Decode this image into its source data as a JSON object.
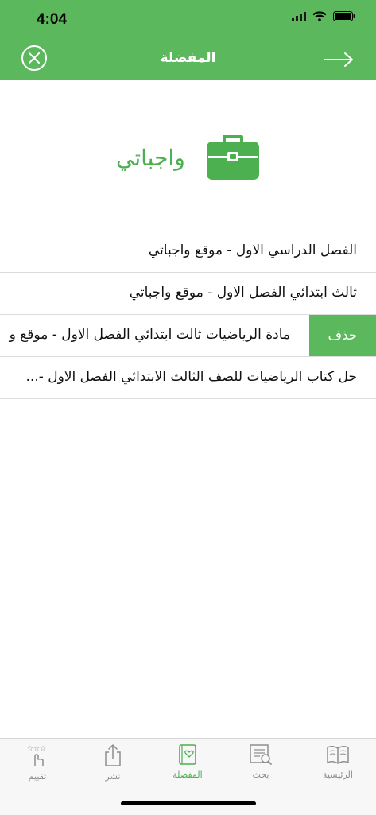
{
  "status_bar": {
    "time": "4:04"
  },
  "nav": {
    "title": "المفضلة"
  },
  "logo": {
    "text": "واجباتي"
  },
  "favorites": [
    {
      "title": "الفصل الدراسي الاول - موقع واجباتي"
    },
    {
      "title": "ثالث ابتدائي الفصل الاول - موقع واجباتي"
    },
    {
      "title": "مادة الرياضيات ثالث ابتدائي الفصل الاول - موقع و",
      "delete_label": "حذف"
    },
    {
      "title": "حل كتاب الرياضيات للصف الثالث الابتدائي الفصل الاول -..."
    }
  ],
  "tabs": [
    {
      "label": "الرئيسية",
      "icon": "book-icon"
    },
    {
      "label": "بحث",
      "icon": "search-document-icon"
    },
    {
      "label": "المفضلة",
      "icon": "favorite-book-icon",
      "active": true
    },
    {
      "label": "نشر",
      "icon": "share-icon"
    },
    {
      "label": "تقييم",
      "icon": "rate-icon"
    }
  ],
  "colors": {
    "accent": "#5cb85c",
    "logo": "#4caf50"
  }
}
